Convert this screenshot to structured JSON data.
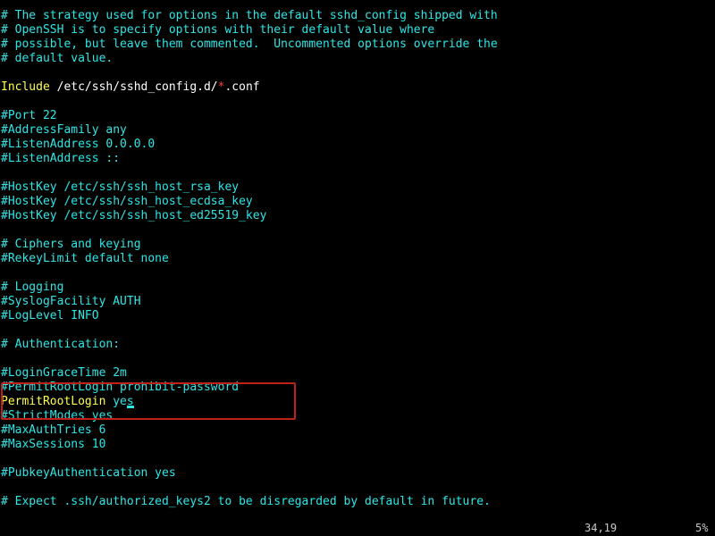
{
  "terminal": {
    "background_color": "#000000",
    "comment_color": "#2ee6e6",
    "keyword_color": "#ffff4d",
    "value_color": "#ffffff",
    "glob_color": "#ff3b30",
    "annotation_color": "#c0201a",
    "status_color": "#c8c8c8"
  },
  "file": {
    "lines": [
      {
        "id": 1,
        "type": "comment",
        "text": "# The strategy used for options in the default sshd_config shipped with"
      },
      {
        "id": 2,
        "type": "comment",
        "text": "# OpenSSH is to specify options with their default value where"
      },
      {
        "id": 3,
        "type": "comment",
        "text": "# possible, but leave them commented.  Uncommented options override the"
      },
      {
        "id": 4,
        "type": "comment",
        "text": "# default value."
      },
      {
        "id": 5,
        "type": "blank",
        "text": ""
      },
      {
        "id": 6,
        "type": "directive_glob",
        "keyword": "Include",
        "value_pre": " /etc/ssh/sshd_config.d/",
        "glob": "*",
        "value_post": ".conf"
      },
      {
        "id": 7,
        "type": "blank",
        "text": ""
      },
      {
        "id": 8,
        "type": "comment",
        "text": "#Port 22"
      },
      {
        "id": 9,
        "type": "comment",
        "text": "#AddressFamily any"
      },
      {
        "id": 10,
        "type": "comment",
        "text": "#ListenAddress 0.0.0.0"
      },
      {
        "id": 11,
        "type": "comment",
        "text": "#ListenAddress ::"
      },
      {
        "id": 12,
        "type": "blank",
        "text": ""
      },
      {
        "id": 13,
        "type": "comment",
        "text": "#HostKey /etc/ssh/ssh_host_rsa_key"
      },
      {
        "id": 14,
        "type": "comment",
        "text": "#HostKey /etc/ssh/ssh_host_ecdsa_key"
      },
      {
        "id": 15,
        "type": "comment",
        "text": "#HostKey /etc/ssh/ssh_host_ed25519_key"
      },
      {
        "id": 16,
        "type": "blank",
        "text": ""
      },
      {
        "id": 17,
        "type": "comment",
        "text": "# Ciphers and keying"
      },
      {
        "id": 18,
        "type": "comment",
        "text": "#RekeyLimit default none"
      },
      {
        "id": 19,
        "type": "blank",
        "text": ""
      },
      {
        "id": 20,
        "type": "comment",
        "text": "# Logging"
      },
      {
        "id": 21,
        "type": "comment",
        "text": "#SyslogFacility AUTH"
      },
      {
        "id": 22,
        "type": "comment",
        "text": "#LogLevel INFO"
      },
      {
        "id": 23,
        "type": "blank",
        "text": ""
      },
      {
        "id": 24,
        "type": "comment",
        "text": "# Authentication:"
      },
      {
        "id": 25,
        "type": "blank",
        "text": ""
      },
      {
        "id": 26,
        "type": "comment",
        "text": "#LoginGraceTime 2m"
      },
      {
        "id": 27,
        "type": "comment",
        "text": "#PermitRootLogin prohibit-password"
      },
      {
        "id": 28,
        "type": "directive_cursor",
        "keyword": "PermitRootLogin",
        "value_pre": " ye",
        "cursor_char": "s"
      },
      {
        "id": 29,
        "type": "comment",
        "text": "#StrictModes yes"
      },
      {
        "id": 30,
        "type": "comment",
        "text": "#MaxAuthTries 6"
      },
      {
        "id": 31,
        "type": "comment",
        "text": "#MaxSessions 10"
      },
      {
        "id": 32,
        "type": "blank",
        "text": ""
      },
      {
        "id": 33,
        "type": "comment",
        "text": "#PubkeyAuthentication yes"
      },
      {
        "id": 34,
        "type": "blank",
        "text": ""
      },
      {
        "id": 35,
        "type": "comment",
        "text": "# Expect .ssh/authorized_keys2 to be disregarded by default in future."
      }
    ]
  },
  "annotation": {
    "label": "permit-root-login-highlight",
    "shape": "rectangle",
    "color": "#c0201a"
  },
  "status_bar": {
    "position": "34,19",
    "percent": "5%"
  }
}
